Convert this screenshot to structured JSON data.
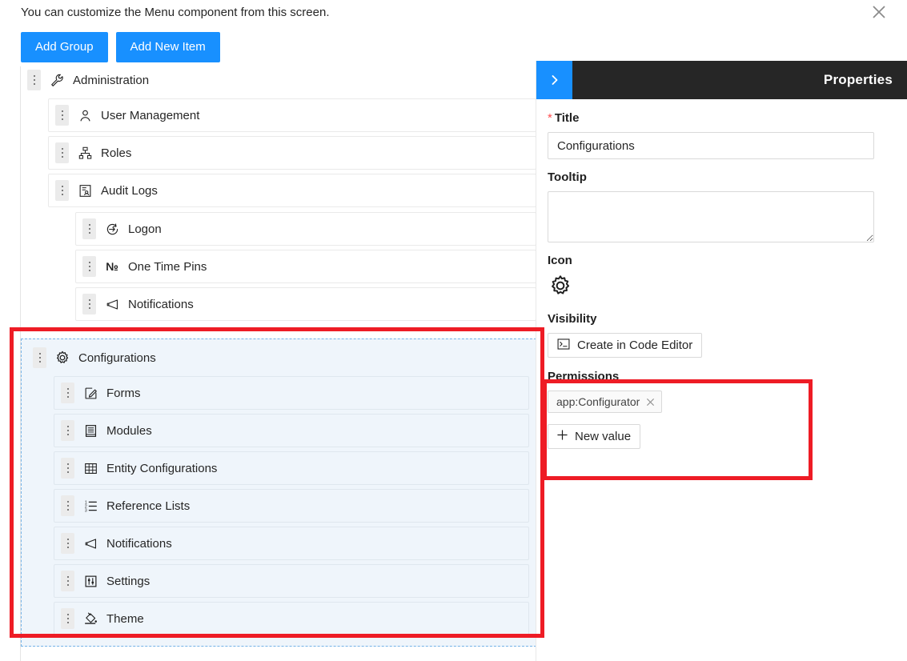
{
  "header": {
    "intro_text": "You can customize the Menu component from this screen.",
    "close_icon": "close-icon"
  },
  "toolbar": {
    "add_group_label": "Add Group",
    "add_new_item_label": "Add New Item"
  },
  "tree": {
    "groups": [
      {
        "label": "Administration",
        "icon": "wrench-icon",
        "selected": false,
        "items": [
          {
            "label": "User Management",
            "icon": "user-icon",
            "children": []
          },
          {
            "label": "Roles",
            "icon": "sitemap-icon",
            "children": []
          },
          {
            "label": "Audit Logs",
            "icon": "audit-icon",
            "children": [
              {
                "label": "Logon",
                "icon": "login-icon"
              },
              {
                "label": "One Time Pins",
                "icon": "numero-icon"
              },
              {
                "label": "Notifications",
                "icon": "megaphone-icon"
              }
            ]
          }
        ]
      },
      {
        "label": "Configurations",
        "icon": "gear-icon",
        "selected": true,
        "items": [
          {
            "label": "Forms",
            "icon": "edit-square-icon",
            "children": []
          },
          {
            "label": "Modules",
            "icon": "module-icon",
            "children": []
          },
          {
            "label": "Entity Configurations",
            "icon": "table-icon",
            "children": []
          },
          {
            "label": "Reference Lists",
            "icon": "ordered-list-icon",
            "children": []
          },
          {
            "label": "Notifications",
            "icon": "megaphone-icon",
            "children": []
          },
          {
            "label": "Settings",
            "icon": "sliders-icon",
            "children": []
          },
          {
            "label": "Theme",
            "icon": "paint-bucket-icon",
            "children": []
          }
        ]
      }
    ]
  },
  "properties": {
    "panel_title": "Properties",
    "collapse_icon": "chevron-right-icon",
    "title_label": "Title",
    "title_required_marker": "*",
    "title_value": "Configurations",
    "tooltip_label": "Tooltip",
    "tooltip_value": "",
    "tooltip_placeholder": "",
    "icon_label": "Icon",
    "icon_value": "gear-icon",
    "visibility_label": "Visibility",
    "visibility_button_label": "Create in Code Editor",
    "visibility_button_icon": "code-console-icon",
    "permissions_label": "Permissions",
    "permission_tags": [
      {
        "label": "app:Configurator",
        "remove_icon": "close-small-icon"
      }
    ],
    "new_value_label": "New value",
    "new_value_icon": "plus-icon"
  },
  "annotations": {
    "highlight_color": "#ee1c25",
    "boxes": [
      {
        "name": "configurations-group-highlight"
      },
      {
        "name": "permissions-highlight"
      }
    ]
  },
  "colors": {
    "primary": "#1890ff",
    "panel_header_bg": "#262626",
    "selected_group_bg": "#eff5fb",
    "selected_group_border": "#74b3e8"
  }
}
